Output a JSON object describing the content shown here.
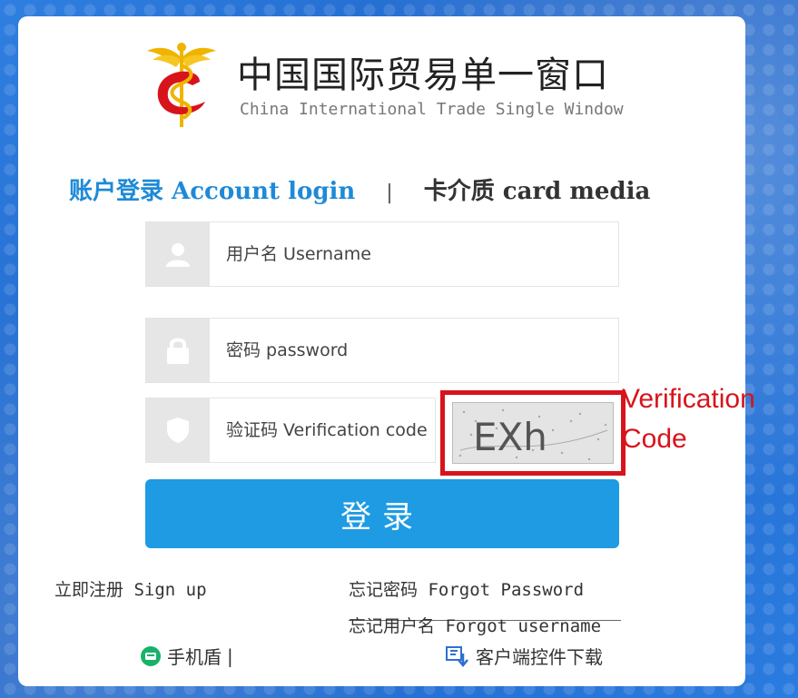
{
  "header": {
    "title_cn": "中国国际贸易单一窗口",
    "title_en": "China International Trade Single Window"
  },
  "tabs": {
    "active": "账户登录 Account login",
    "separator": "|",
    "card": "卡介质 card media"
  },
  "form": {
    "username_placeholder": "用户名 Username",
    "password_placeholder": "密码 password",
    "captcha_placeholder": "验证码 Verification code",
    "captcha_text": "EXh",
    "captcha_label": "Verification Code",
    "login_button": "登录"
  },
  "links": {
    "signup_cn": "立即注册",
    "signup_en": "Sign up",
    "forgot_password_cn": "忘记密码",
    "forgot_password_en": "Forgot Password",
    "forgot_username_cn": "忘记用户名",
    "forgot_username_en": "Forgot username",
    "mobile_shield": "手机盾",
    "mobile_shield_sep": "|",
    "client_download": "客户端控件下载"
  },
  "colors": {
    "accent": "#1e9be3",
    "highlight": "#d7141c",
    "background": "#2a74d6"
  },
  "icons": [
    "user-icon",
    "lock-icon",
    "shield-icon",
    "phone-shield-icon",
    "download-icon",
    "caduceus-logo"
  ]
}
